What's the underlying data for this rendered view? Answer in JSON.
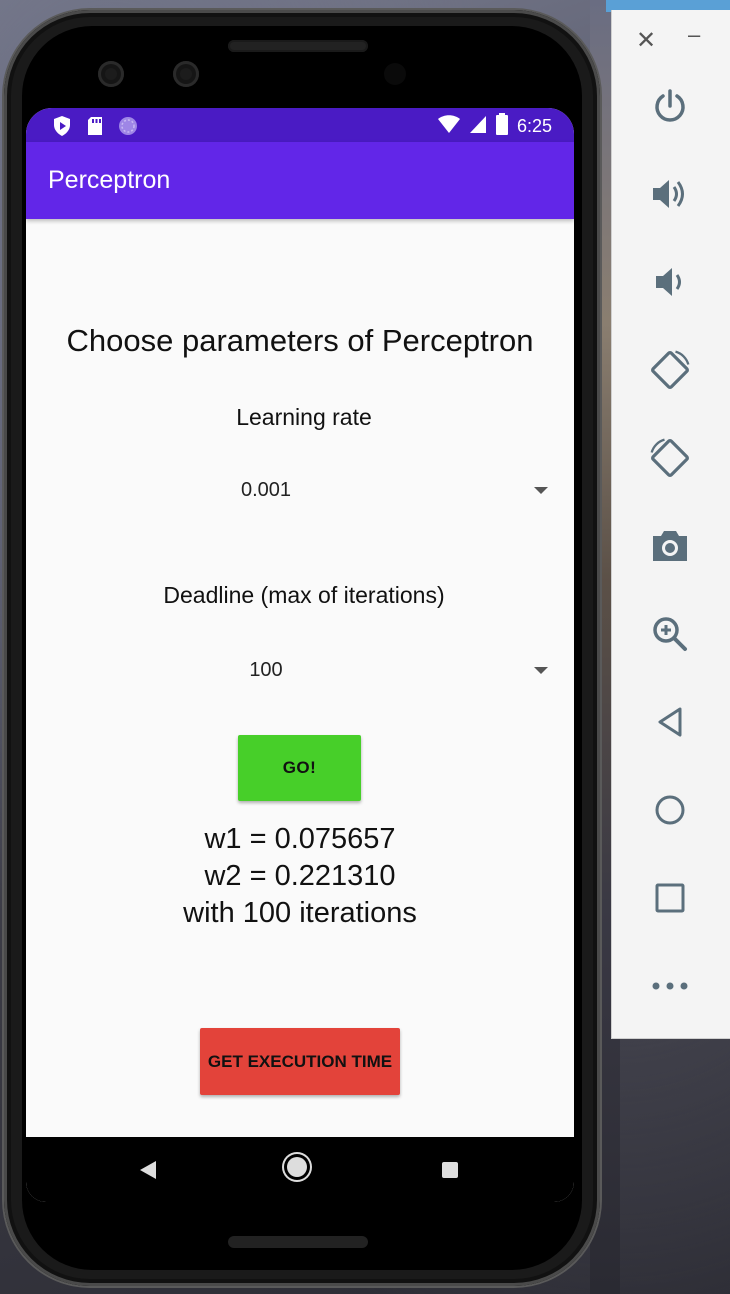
{
  "status_bar": {
    "time": "6:25",
    "left_icons": [
      "shield-icon",
      "sd-card-icon",
      "circle-dots-icon"
    ],
    "right_icons": [
      "wifi-icon",
      "signal-icon",
      "battery-icon"
    ]
  },
  "app": {
    "title": "Perceptron"
  },
  "main": {
    "heading": "Choose parameters of Perceptron",
    "learning_rate_label": "Learning rate",
    "learning_rate_value": "0.001",
    "deadline_label": "Deadline (max of iterations)",
    "deadline_value": "100",
    "go_button": "GO!",
    "result_w1": "w1 = 0.075657",
    "result_w2": "w2 = 0.221310",
    "result_iterations": "with 100 iterations",
    "exec_button": "GET EXECUTION TIME"
  },
  "colors": {
    "status_bar": "#4a1bc4",
    "app_bar": "#6226e8",
    "go_button": "#47cf29",
    "exec_button": "#e3433a"
  },
  "emulator_toolbar": {
    "items": [
      "close-icon",
      "minimize-icon",
      "power-icon",
      "volume-up-icon",
      "volume-down-icon",
      "rotate-left-icon",
      "rotate-right-icon",
      "camera-icon",
      "zoom-icon",
      "back-icon",
      "home-icon",
      "overview-icon",
      "more-icon"
    ]
  }
}
